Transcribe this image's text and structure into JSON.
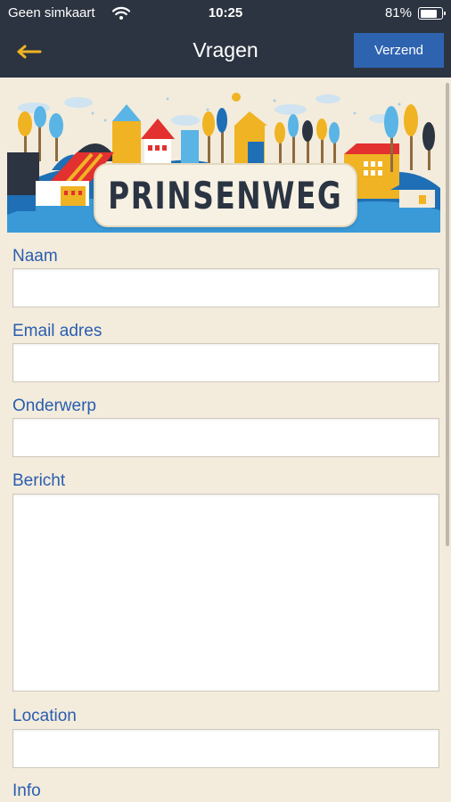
{
  "status_bar": {
    "carrier": "Geen simkaart",
    "time": "10:25",
    "battery_text": "81%",
    "battery_level": 0.81,
    "wifi_icon": "wifi-icon"
  },
  "nav_bar": {
    "title": "Vragen",
    "send_label": "Verzend",
    "back_icon": "arrow-left-icon",
    "accent_color": "#f0b323"
  },
  "banner": {
    "logo_text": "PRINSENWEG"
  },
  "form": {
    "name_label": "Naam",
    "name_value": "",
    "email_label": "Email adres",
    "email_value": "",
    "subject_label": "Onderwerp",
    "subject_value": "",
    "message_label": "Bericht",
    "message_value": "",
    "location_label": "Location",
    "location_value": "",
    "info_label": "Info"
  },
  "colors": {
    "header_bg": "#2c3441",
    "button_bg": "#2e63b0",
    "label_color": "#2a5db0",
    "page_bg": "#f3ecdc"
  }
}
